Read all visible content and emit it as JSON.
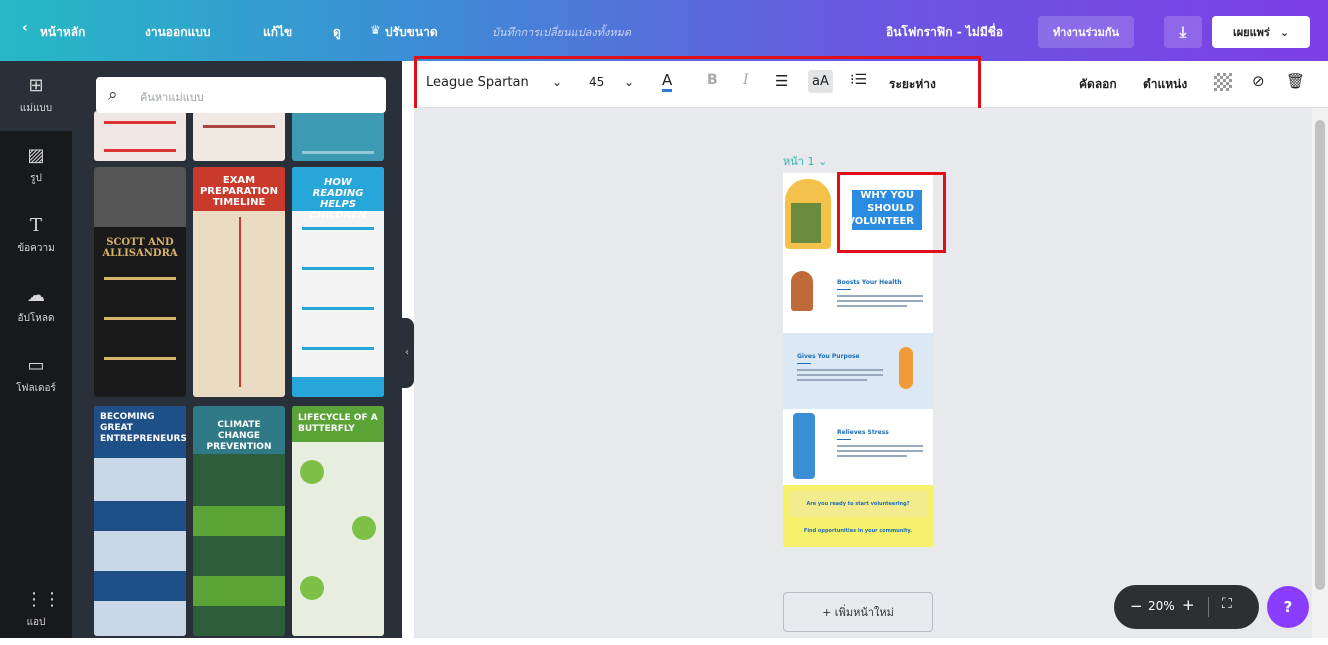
{
  "topbar": {
    "back_label": "หน้าหลัก",
    "menu": [
      "งานออกแบบ",
      "แก้ไข",
      "ดู",
      "ปรับขนาด"
    ],
    "saved_status": "บันทึกการเปลี่ยนแปลงทั้งหมด",
    "doc_title": "อินโฟกราฟิก - ไม่มีชื่อ",
    "collaborate_label": "ทำงานร่วมกัน",
    "publish_label": "เผยแพร่"
  },
  "rail": {
    "items": [
      "แม่แบบ",
      "รูป",
      "ข้อความ",
      "อัปโหลด",
      "โฟลเดอร์"
    ],
    "apps_label": "แอป"
  },
  "panel": {
    "search_placeholder": "ค้นหาแม่แบบ",
    "templates": [
      {
        "title": "SCOTT AND ALLISANDRA"
      },
      {
        "title": "EXAM PREPARATION TIMELINE"
      },
      {
        "title": "HOW READING HELPS CHILDREN"
      },
      {
        "title": "BECOMING GREAT ENTREPRENEURS"
      },
      {
        "title": "CLIMATE CHANGE PREVENTION"
      },
      {
        "title": "LIFECYCLE OF A BUTTERFLY"
      }
    ]
  },
  "toolbar": {
    "font": "League Spartan",
    "size": "45",
    "spacing_label": "ระยะห่าง",
    "copy_label": "คัดลอก",
    "position_label": "ตำแหน่ง",
    "case_label": "aA"
  },
  "canvas": {
    "page_label": "หน้า 1",
    "title_words": [
      "WHY YOU",
      "SHOULD",
      "VOLUNTEER"
    ],
    "sections": [
      "Boosts Your Health",
      "Gives You Purpose",
      "Relieves Stress"
    ],
    "footer_q": "Are you ready to start volunteering?",
    "footer_a": "Find opportunities in your community.",
    "add_page_label": "+ เพิ่มหน้าใหม่"
  },
  "zoom": {
    "level": "20%",
    "minus": "−",
    "plus": "+"
  },
  "help_label": "?",
  "colors": {
    "accent": "#8b3dff",
    "selection": "#e0101a",
    "canvas_text": "#1c6db4"
  }
}
